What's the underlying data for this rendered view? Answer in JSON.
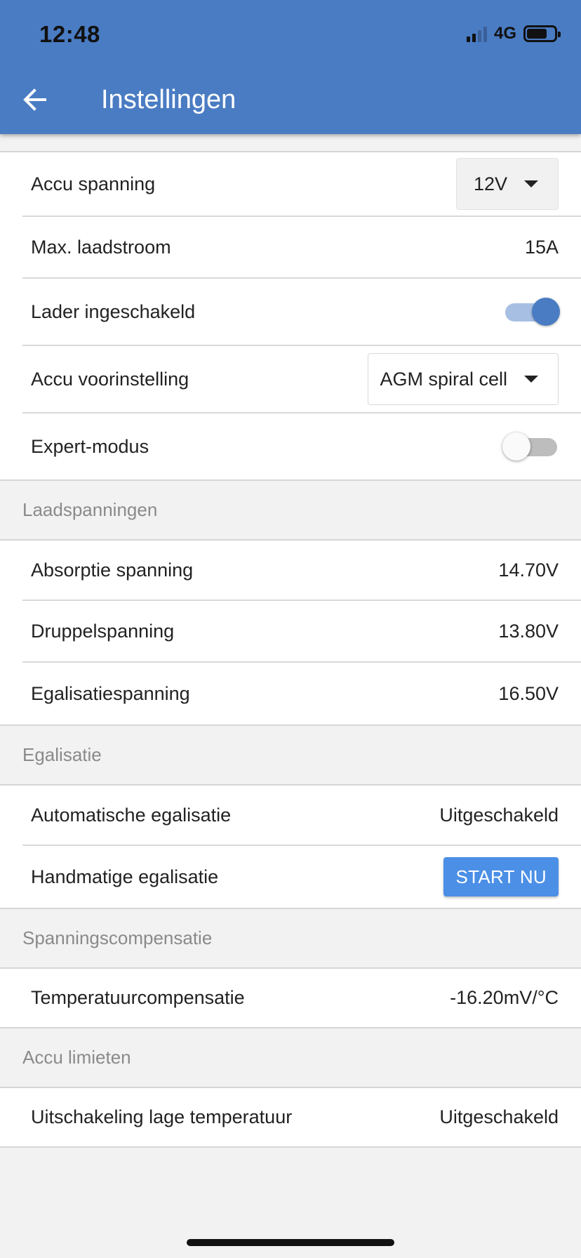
{
  "status_bar": {
    "time": "12:48",
    "network": "4G",
    "signal_bars": 2,
    "battery_level": 0.65
  },
  "header": {
    "title": "Instellingen",
    "back_icon": "arrow-left-icon"
  },
  "colors": {
    "primary": "#4a7cc3",
    "button": "#4b8fe6",
    "toggle_on_track": "#a7bfe3",
    "toggle_off_track": "#bdbdbd"
  },
  "general": {
    "battery_voltage": {
      "label": "Accu spanning",
      "value": "12V"
    },
    "max_charge_current": {
      "label": "Max. laadstroom",
      "value": "15A"
    },
    "charger_enabled": {
      "label": "Lader ingeschakeld",
      "on": true
    },
    "battery_preset": {
      "label": "Accu voorinstelling",
      "value": "AGM spiral cell"
    },
    "expert_mode": {
      "label": "Expert-modus",
      "on": false
    }
  },
  "charge_voltages": {
    "header": "Laadspanningen",
    "absorption": {
      "label": "Absorptie spanning",
      "value": "14.70V"
    },
    "float": {
      "label": "Druppelspanning",
      "value": "13.80V"
    },
    "equalization": {
      "label": "Egalisatiespanning",
      "value": "16.50V"
    }
  },
  "equalization": {
    "header": "Egalisatie",
    "automatic": {
      "label": "Automatische egalisatie",
      "value": "Uitgeschakeld"
    },
    "manual": {
      "label": "Handmatige egalisatie",
      "button": "START NU"
    }
  },
  "voltage_compensation": {
    "header": "Spanningscompensatie",
    "temperature": {
      "label": "Temperatuurcompensatie",
      "value": "-16.20mV/°C"
    }
  },
  "battery_limits": {
    "header": "Accu limieten",
    "low_temp_cutoff": {
      "label": "Uitschakeling lage temperatuur",
      "value": "Uitgeschakeld"
    }
  }
}
